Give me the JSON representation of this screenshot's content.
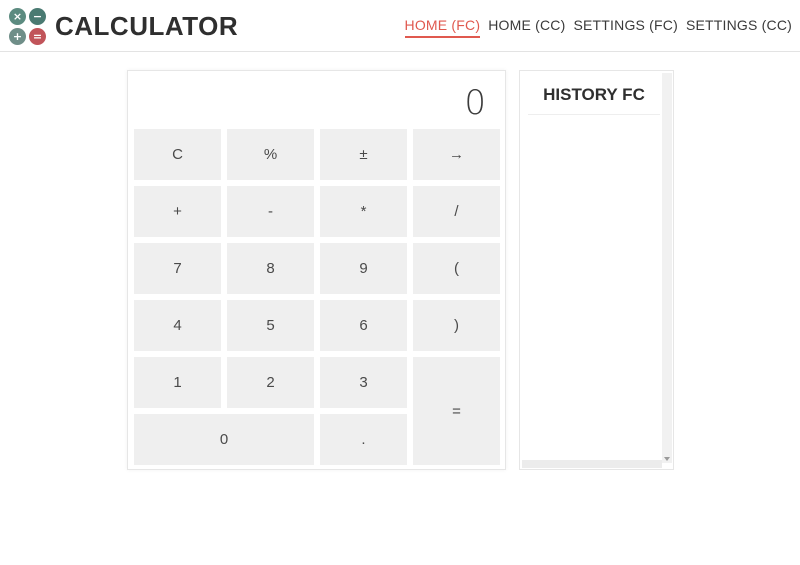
{
  "app": {
    "title": "CALCULATOR",
    "logo_icon": "calculator-logo-icon",
    "logo_glyphs": [
      "×",
      "−",
      "+",
      "="
    ]
  },
  "nav": {
    "items": [
      {
        "label": "HOME (FC)",
        "active": true
      },
      {
        "label": "HOME (CC)",
        "active": false
      },
      {
        "label": "SETTINGS (FC)",
        "active": false
      },
      {
        "label": "SETTINGS (CC)",
        "active": false
      }
    ]
  },
  "calculator": {
    "display_value": "0",
    "keys": [
      {
        "label": "C",
        "name": "clear-key"
      },
      {
        "label": "%",
        "name": "percent-key"
      },
      {
        "label": "±",
        "name": "sign-key"
      },
      {
        "label": "→",
        "name": "backspace-key"
      },
      {
        "label": "+",
        "name": "add-key"
      },
      {
        "label": "-",
        "name": "subtract-key"
      },
      {
        "label": "*",
        "name": "multiply-key"
      },
      {
        "label": "/",
        "name": "divide-key"
      },
      {
        "label": "7",
        "name": "digit-7-key"
      },
      {
        "label": "8",
        "name": "digit-8-key"
      },
      {
        "label": "9",
        "name": "digit-9-key"
      },
      {
        "label": "(",
        "name": "open-paren-key"
      },
      {
        "label": "4",
        "name": "digit-4-key"
      },
      {
        "label": "5",
        "name": "digit-5-key"
      },
      {
        "label": "6",
        "name": "digit-6-key"
      },
      {
        "label": ")",
        "name": "close-paren-key"
      },
      {
        "label": "1",
        "name": "digit-1-key"
      },
      {
        "label": "2",
        "name": "digit-2-key"
      },
      {
        "label": "3",
        "name": "digit-3-key"
      },
      {
        "label": "=",
        "name": "equals-key"
      },
      {
        "label": "0",
        "name": "digit-0-key"
      },
      {
        "label": ".",
        "name": "decimal-key"
      }
    ]
  },
  "history": {
    "title": "HISTORY FC",
    "entries": []
  },
  "colors": {
    "accent": "#e0594f",
    "key_bg": "#efefef",
    "text": "#3a3a3a"
  }
}
